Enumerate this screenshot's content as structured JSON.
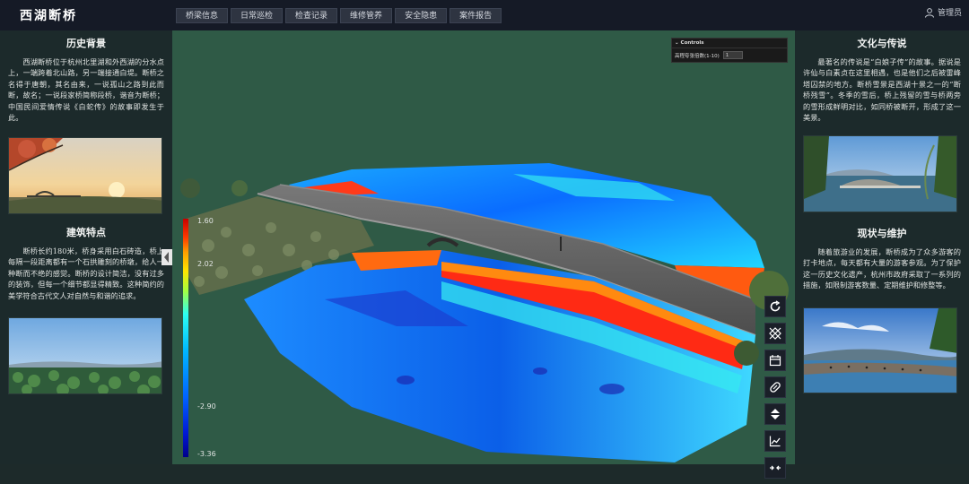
{
  "header": {
    "brand": "西湖断桥",
    "nav": [
      "桥梁信息",
      "日常巡检",
      "检查记录",
      "维修管养",
      "安全隐患",
      "案件报告"
    ],
    "user": "管理员"
  },
  "left": {
    "history_title": "历史背景",
    "history_text": "西湖断桥位于杭州北里湖和外西湖的分水点上，一端跨着北山路，另一端接通白堤。断桥之名得于唐朝，其名由来，一说孤山之路到此而断，故名；一说段家桥简称段桥，谐音为断桥；中国民间爱情传说《白蛇传》的故事即发生于此。",
    "feature_title": "建筑特点",
    "feature_text": "断桥长约180米，桥身采用白石砖造，桥上每隔一段距离都有一个石拱雕刻的桥墩，给人一种断而不绝的感觉。断桥的设计简洁，没有过多的装饰，但每一个细节都显得精致。这种简约的美学符合古代文人对自然与和谐的追求。"
  },
  "right": {
    "culture_title": "文化与传说",
    "culture_text": "最著名的传说是“白娘子传”的故事。据说是许仙与白素贞在这里相遇，也是他们之后被雷峰塔囚禁的地方。断桥雪景是西湖十景之一的“断桥残雪”。冬季的雪后，桥上残留的雪与桥两旁的雪形成鲜明对比，如同桥被断开，形成了这一美景。",
    "status_title": "现状与维护",
    "status_text": "随着旅游业的发展，断桥成为了众多游客的打卡地点，每天都有大量的游客参观。为了保护这一历史文化遗产，杭州市政府采取了一系列的措施，如限制游客数量、定期维护和修整等。"
  },
  "viewer": {
    "controls_title": "Controls",
    "controls_label": "高程夸张倍数(1-10)",
    "controls_value": "1",
    "colorbar_labels": [
      "1.60",
      "2.02",
      "-2.90",
      "-3.36"
    ]
  },
  "tools": [
    "rotate-icon",
    "grid-icon",
    "calendar-icon",
    "ruler-icon",
    "vertical-resize-icon",
    "chart-icon",
    "compress-icon"
  ]
}
